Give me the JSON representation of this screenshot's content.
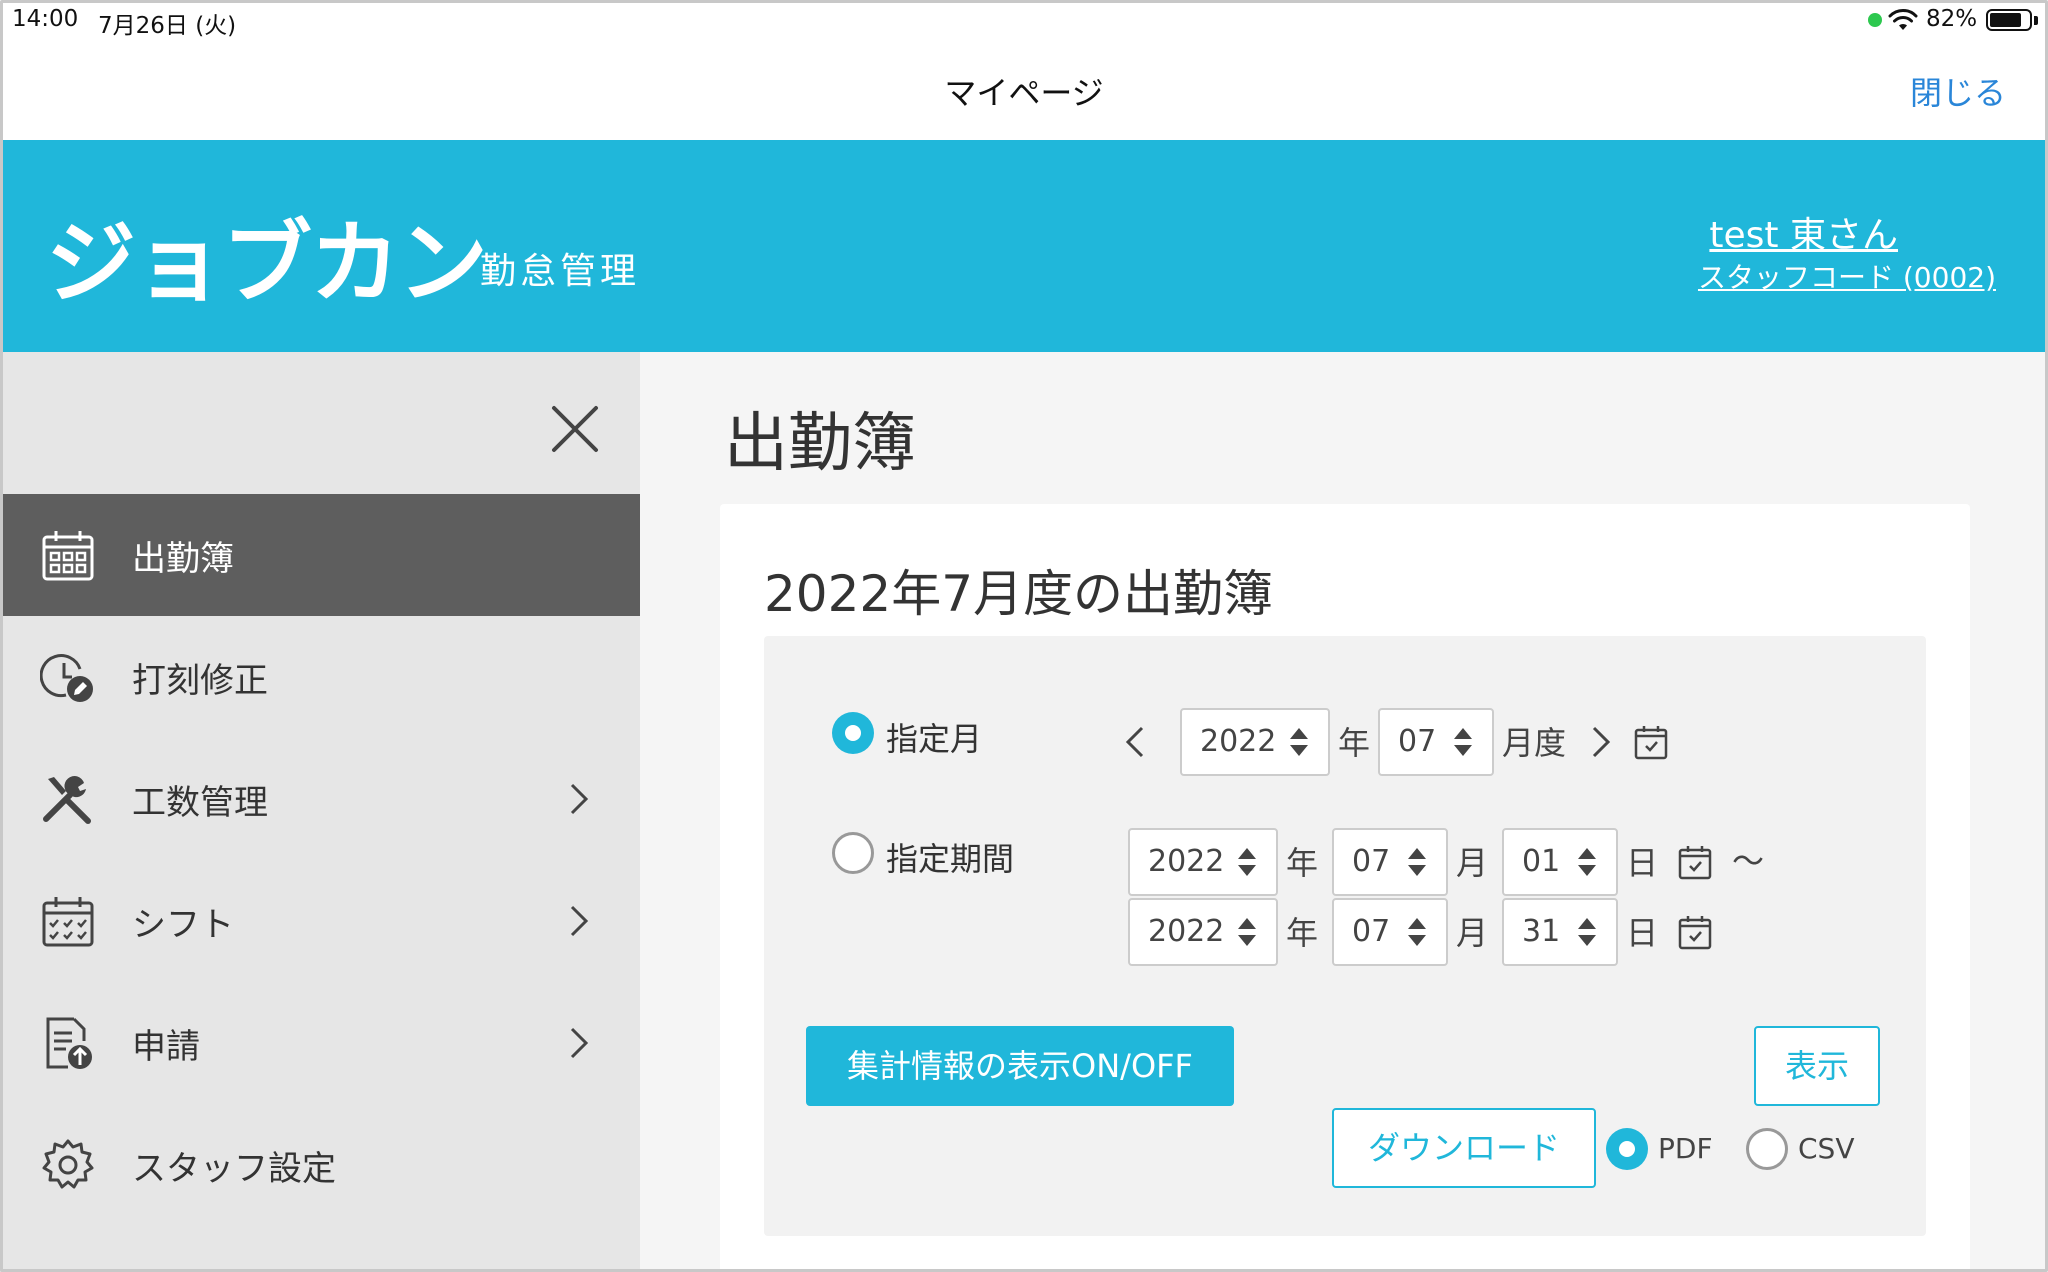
{
  "status_bar": {
    "time": "14:00",
    "date": "7月26日 (火)",
    "battery_percent": "82%",
    "battery_level": 0.82
  },
  "nav": {
    "title": "マイページ",
    "close_label": "閉じる"
  },
  "header": {
    "logo": "ジョブカン",
    "logo_sub": "勤怠管理",
    "user_name": "test 東さん",
    "staff_code": "スタッフコード (0002)"
  },
  "sidebar": {
    "items": [
      {
        "label": "出勤簿",
        "icon": "calendar-grid-icon",
        "active": true,
        "has_submenu": false
      },
      {
        "label": "打刻修正",
        "icon": "clock-edit-icon",
        "active": false,
        "has_submenu": false
      },
      {
        "label": "工数管理",
        "icon": "tools-icon",
        "active": false,
        "has_submenu": true
      },
      {
        "label": "シフト",
        "icon": "calendar-check-icon",
        "active": false,
        "has_submenu": true
      },
      {
        "label": "申請",
        "icon": "document-upload-icon",
        "active": false,
        "has_submenu": true
      },
      {
        "label": "スタッフ設定",
        "icon": "gear-icon",
        "active": false,
        "has_submenu": false
      }
    ]
  },
  "main": {
    "page_title": "出勤簿",
    "card_title": "2022年7月度の出勤簿",
    "month_mode": {
      "label": "指定月",
      "selected": true,
      "year": "2022",
      "year_unit": "年",
      "month": "07",
      "month_unit": "月度"
    },
    "period_mode": {
      "label": "指定期間",
      "selected": false,
      "from": {
        "year": "2022",
        "month": "07",
        "day": "01"
      },
      "to": {
        "year": "2022",
        "month": "07",
        "day": "31"
      },
      "year_unit": "年",
      "month_unit": "月",
      "day_unit": "日",
      "range_sep": "〜"
    },
    "toggle_summary_label": "集計情報の表示ON/OFF",
    "show_label": "表示",
    "download_label": "ダウンロード",
    "formats": [
      {
        "label": "PDF",
        "selected": true
      },
      {
        "label": "CSV",
        "selected": false
      }
    ]
  },
  "colors": {
    "brand": "#20b7da",
    "link": "#2a86d8",
    "sidebar_active": "#5e5e5e"
  }
}
